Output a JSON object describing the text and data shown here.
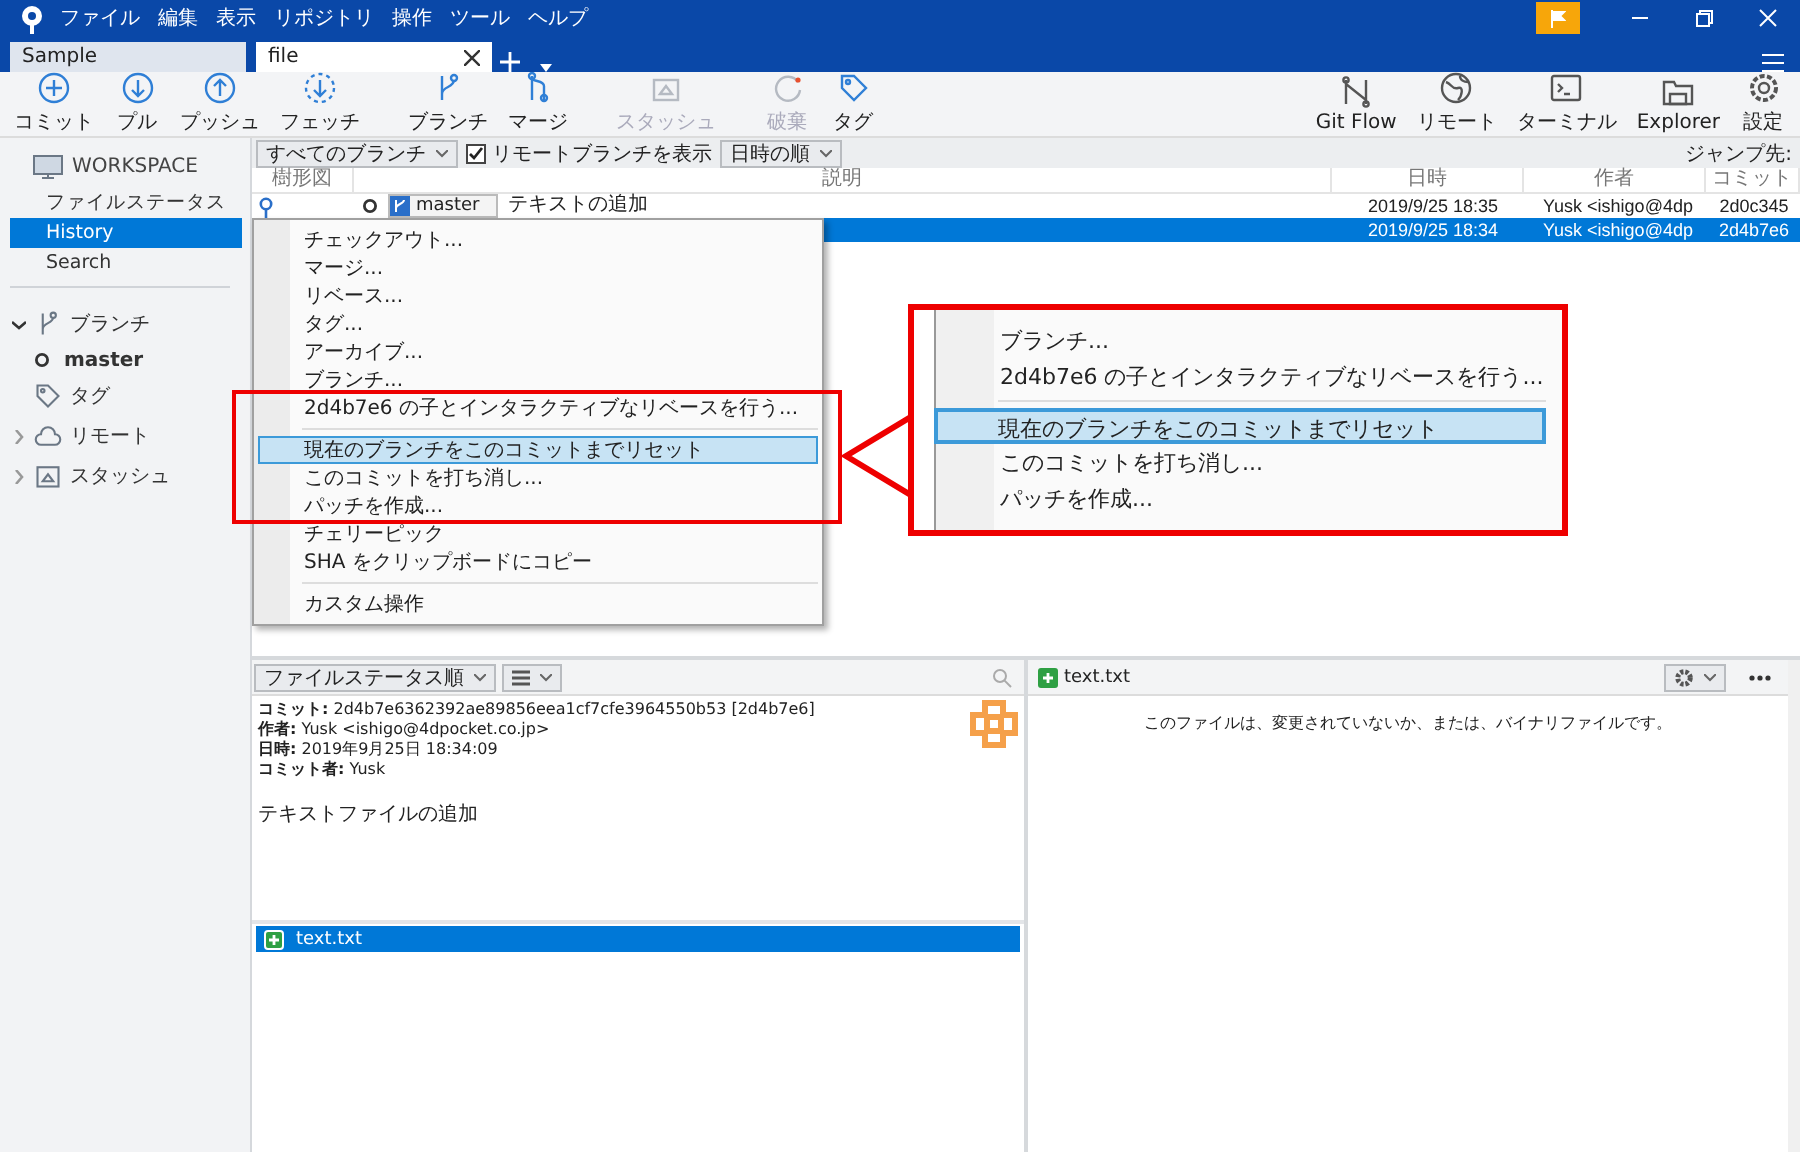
{
  "menu": [
    "ファイル",
    "編集",
    "表示",
    "リポジトリ",
    "操作",
    "ツール",
    "ヘルプ"
  ],
  "tabs": [
    {
      "label": "Sample",
      "selected": false
    },
    {
      "label": "file",
      "selected": true
    }
  ],
  "toolbar_left": [
    {
      "label": "コミット",
      "kind": "commit",
      "disabled": false
    },
    {
      "label": "プル",
      "kind": "pull",
      "disabled": false
    },
    {
      "label": "プッシュ",
      "kind": "push",
      "disabled": false
    },
    {
      "label": "フェッチ",
      "kind": "fetch",
      "disabled": false
    },
    {
      "label": "ブランチ",
      "kind": "branch",
      "disabled": false
    },
    {
      "label": "マージ",
      "kind": "merge",
      "disabled": false
    },
    {
      "label": "スタッシュ",
      "kind": "stash",
      "disabled": true
    },
    {
      "label": "破棄",
      "kind": "discard",
      "disabled": true
    },
    {
      "label": "タグ",
      "kind": "tag",
      "disabled": false
    }
  ],
  "toolbar_right": [
    {
      "label": "Git Flow",
      "kind": "gitflow"
    },
    {
      "label": "リモート",
      "kind": "remote"
    },
    {
      "label": "ターミナル",
      "kind": "terminal"
    },
    {
      "label": "Explorer",
      "kind": "explorer"
    },
    {
      "label": "設定",
      "kind": "settings"
    }
  ],
  "sidebar": {
    "workspace": "WORKSPACE",
    "items": [
      {
        "label": "ファイルステータス",
        "selected": false
      },
      {
        "label": "History",
        "selected": true
      },
      {
        "label": "Search",
        "selected": false
      }
    ],
    "sections": [
      {
        "label": "ブランチ",
        "kind": "branch",
        "expanded": true,
        "children": [
          {
            "label": "master"
          }
        ]
      },
      {
        "label": "タグ",
        "kind": "tag"
      },
      {
        "label": "リモート",
        "kind": "remote",
        "expanded": false
      },
      {
        "label": "スタッシュ",
        "kind": "stash",
        "expanded": false
      }
    ]
  },
  "filters": {
    "branches": "すべてのブランチ",
    "show_remote": {
      "label": "リモートブランチを表示",
      "checked": true
    },
    "sort": "日時の順",
    "jump": "ジャンプ先:"
  },
  "table": {
    "columns": [
      "樹形図",
      "説明",
      "日時",
      "作者",
      "コミット"
    ],
    "rows": [
      {
        "branch": "master",
        "description": "テキストの追加",
        "date": "2019/9/25  18:35",
        "author": "Yusk <ishigo@4dp",
        "commit": "2d0c345",
        "selected": false
      },
      {
        "date": "2019/9/25  18:34",
        "author": "Yusk <ishigo@4dp",
        "commit": "2d4b7e6",
        "selected": true
      }
    ]
  },
  "context_menu": [
    {
      "kind": "item",
      "label": "チェックアウト...",
      "highlighted": false
    },
    {
      "kind": "item",
      "label": "マージ...",
      "highlighted": false
    },
    {
      "kind": "item",
      "label": "リベース...",
      "highlighted": false
    },
    {
      "kind": "item",
      "label": "タグ...",
      "highlighted": false
    },
    {
      "kind": "item",
      "label": "アーカイブ...",
      "highlighted": false
    },
    {
      "kind": "item",
      "label": "ブランチ...",
      "highlighted": false
    },
    {
      "kind": "item",
      "label": "2d4b7e6 の子とインタラクティブなリベースを行う...",
      "highlighted": false
    },
    {
      "kind": "separator"
    },
    {
      "kind": "item",
      "label": "現在のブランチをこのコミットまでリセット",
      "highlighted": true
    },
    {
      "kind": "item",
      "label": "このコミットを打ち消し...",
      "highlighted": false
    },
    {
      "kind": "item",
      "label": "パッチを作成...",
      "highlighted": false
    },
    {
      "kind": "item",
      "label": "チェリーピック",
      "highlighted": false
    },
    {
      "kind": "item",
      "label": "SHA をクリップボードにコピー",
      "highlighted": false
    },
    {
      "kind": "separator"
    },
    {
      "kind": "item",
      "label": "カスタム操作",
      "highlighted": false
    }
  ],
  "callout": [
    {
      "kind": "item",
      "label": "ブランチ...",
      "highlighted": false
    },
    {
      "kind": "item",
      "label": "2d4b7e6 の子とインタラクティブなリベースを行う...",
      "highlighted": false
    },
    {
      "kind": "separator"
    },
    {
      "kind": "item",
      "label": "現在のブランチをこのコミットまでリセット",
      "highlighted": true
    },
    {
      "kind": "item",
      "label": "このコミットを打ち消し...",
      "highlighted": false
    },
    {
      "kind": "item",
      "label": "パッチを作成...",
      "highlighted": false
    }
  ],
  "details": {
    "sort": "ファイルステータス順",
    "lines": [
      "**コミット:** 2d4b7e6362392ae89856eea1cf7cfe3964550b53 [2d4b7e6]",
      "**作者:** Yusk <ishigo@4dpocket.co.jp>",
      "**日時:** 2019年9月25日 18:34:09",
      "**コミット者:** Yusk"
    ],
    "message": "テキストファイルの追加",
    "files": [
      {
        "name": "text.txt",
        "selected": true
      }
    ]
  },
  "diff": {
    "file": "text.txt",
    "message": "このファイルは、変更されていないか、または、バイナリファイルです。"
  }
}
